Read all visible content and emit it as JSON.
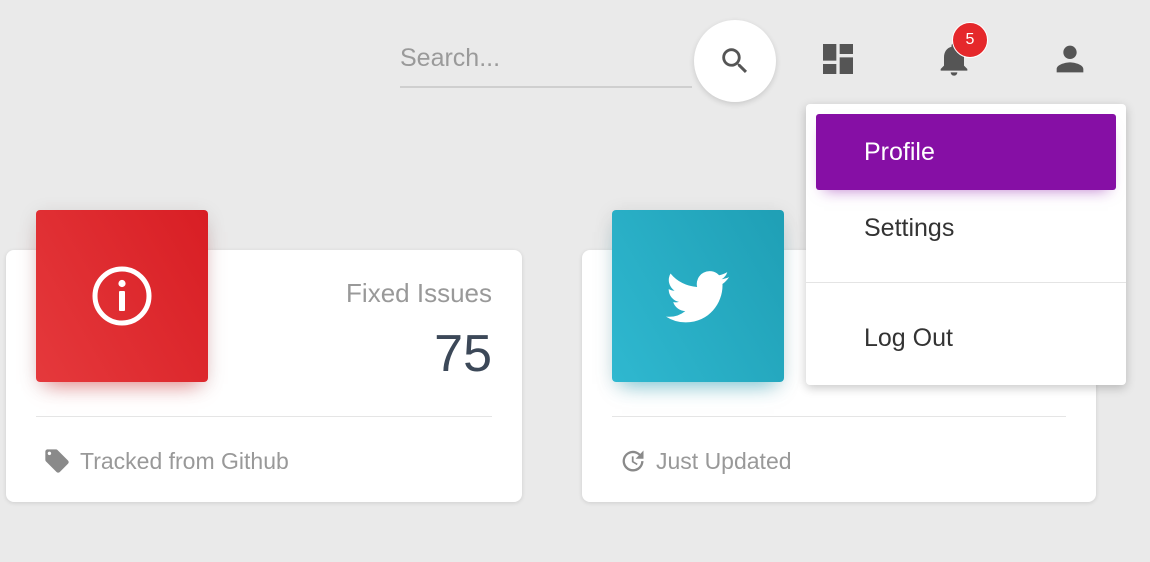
{
  "navbar": {
    "search": {
      "placeholder": "Search...",
      "value": ""
    },
    "notifications": {
      "count": "5"
    },
    "icons": {
      "search": "search-icon",
      "dashboard": "dashboard-icon",
      "notifications": "bell-icon",
      "profile": "person-icon"
    }
  },
  "cards": [
    {
      "category": "Fixed Issues",
      "value": "75",
      "footer": "Tracked from Github",
      "icon": "info-icon",
      "footer_icon": "tag-icon",
      "color": "#e5393c"
    },
    {
      "category": "",
      "value": "",
      "footer": "Just Updated",
      "icon": "twitter-icon",
      "footer_icon": "update-icon",
      "color": "#26abc3"
    }
  ],
  "profile_menu": {
    "items": [
      "Profile",
      "Settings",
      "Log Out"
    ],
    "active": "Profile",
    "accent": "#860fa5"
  }
}
